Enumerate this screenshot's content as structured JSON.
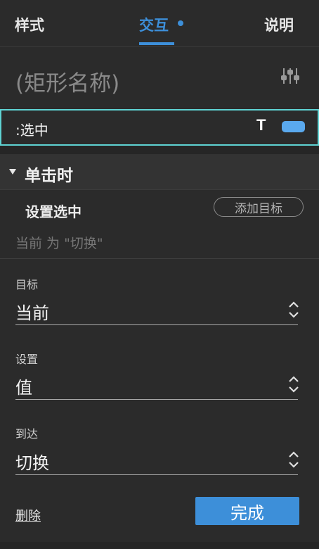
{
  "tabs": {
    "style": "样式",
    "interactions": "交互",
    "notes": "说明",
    "active_color": "#3d8fd9"
  },
  "shape": {
    "name": "(矩形名称)",
    "settings_icon": "sliders-icon"
  },
  "state": {
    "label": ":选中",
    "text_icon": "T",
    "chip_color": "#5aa9ee",
    "border_color": "#5fd3d3"
  },
  "event": {
    "title": "单击时",
    "action": {
      "title": "设置选中",
      "add_target": "添加目标",
      "description": "当前 为 \"切换\""
    }
  },
  "form": {
    "target": {
      "label": "目标",
      "value": "当前"
    },
    "set": {
      "label": "设置",
      "value": "值"
    },
    "to": {
      "label": "到达",
      "value": "切换"
    }
  },
  "footer": {
    "delete": "删除",
    "done": "完成"
  }
}
